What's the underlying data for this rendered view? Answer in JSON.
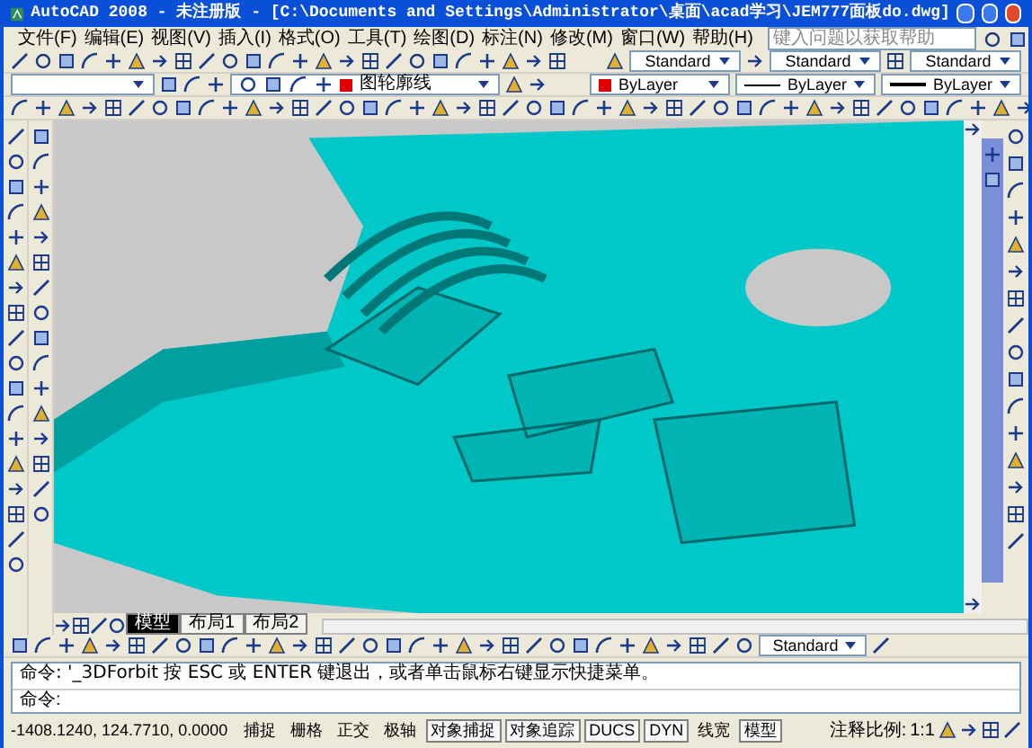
{
  "window": {
    "title": "AutoCAD 2008 - 未注册版 - [C:\\Documents and Settings\\Administrator\\桌面\\acad学习\\JEM777面板do.dwg]"
  },
  "menu": [
    "文件(F)",
    "编辑(E)",
    "视图(V)",
    "插入(I)",
    "格式(O)",
    "工具(T)",
    "绘图(D)",
    "标注(N)",
    "修改(M)",
    "窗口(W)",
    "帮助(H)"
  ],
  "help_search": {
    "placeholder": "键入问题以获取帮助"
  },
  "styles": [
    "Standard",
    "Standard",
    "Standard"
  ],
  "layer": {
    "name": "图轮廓线",
    "color": "#e00000"
  },
  "properties": [
    {
      "kind": "color",
      "value": "ByLayer"
    },
    {
      "kind": "linetype",
      "value": "ByLayer"
    },
    {
      "kind": "lineweight",
      "value": "ByLayer"
    }
  ],
  "tabs": [
    {
      "label": "模型",
      "selected": true
    },
    {
      "label": "布局1",
      "selected": false
    },
    {
      "label": "布局2",
      "selected": false
    }
  ],
  "dim_style": "Standard",
  "command": {
    "history": "命令: '_3DForbit 按 ESC 或 ENTER 键退出，或者单击鼠标右键显示快捷菜单。",
    "prompt": "命令:"
  },
  "status_bar": {
    "coordinates": "-1408.1240, 124.7710, 0.0000",
    "toggles": [
      {
        "label": "捕捉",
        "on": false
      },
      {
        "label": "栅格",
        "on": false
      },
      {
        "label": "正交",
        "on": false
      },
      {
        "label": "极轴",
        "on": false
      },
      {
        "label": "对象捕捉",
        "on": true
      },
      {
        "label": "对象追踪",
        "on": true
      },
      {
        "label": "DUCS",
        "on": true
      },
      {
        "label": "DYN",
        "on": true
      },
      {
        "label": "线宽",
        "on": false
      },
      {
        "label": "模型",
        "on": true
      }
    ],
    "scale_label": "注释比例:",
    "scale": "1:1"
  }
}
